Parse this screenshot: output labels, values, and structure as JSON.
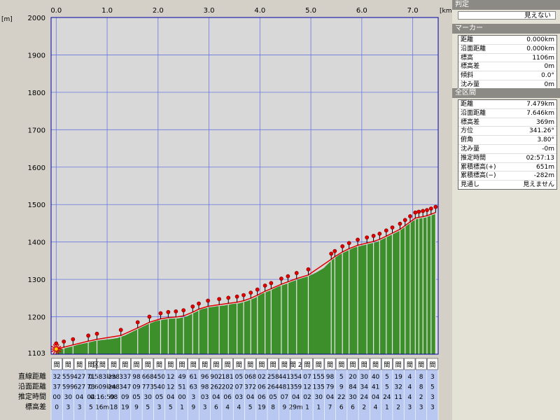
{
  "chart_data": {
    "type": "area",
    "title": "",
    "xunit": "[km]",
    "yunit": "[m]",
    "xlim": [
      -0.1,
      7.5
    ],
    "ylim": [
      1100,
      2000
    ],
    "x_ticks": [
      "0.0",
      "1.0",
      "2.0",
      "3.0",
      "4.0",
      "5.0",
      "6.0",
      "7.0"
    ],
    "y_ticks": [
      "2000",
      "1900",
      "1800",
      "1700",
      "1600",
      "1500",
      "1400",
      "1300",
      "1200"
    ],
    "y_bottom_label": "1103",
    "profile": [
      [
        0.0,
        1110
      ],
      [
        0.15,
        1115
      ],
      [
        0.3,
        1120
      ],
      [
        0.45,
        1126
      ],
      [
        0.6,
        1130
      ],
      [
        0.75,
        1135
      ],
      [
        0.9,
        1138
      ],
      [
        1.05,
        1140
      ],
      [
        1.2,
        1143
      ],
      [
        1.35,
        1150
      ],
      [
        1.5,
        1160
      ],
      [
        1.65,
        1170
      ],
      [
        1.8,
        1180
      ],
      [
        1.95,
        1188
      ],
      [
        2.1,
        1192
      ],
      [
        2.25,
        1195
      ],
      [
        2.4,
        1196
      ],
      [
        2.55,
        1200
      ],
      [
        2.7,
        1210
      ],
      [
        2.85,
        1220
      ],
      [
        3.0,
        1225
      ],
      [
        3.15,
        1228
      ],
      [
        3.3,
        1230
      ],
      [
        3.45,
        1234
      ],
      [
        3.6,
        1236
      ],
      [
        3.75,
        1242
      ],
      [
        3.9,
        1250
      ],
      [
        4.05,
        1262
      ],
      [
        4.2,
        1270
      ],
      [
        4.35,
        1280
      ],
      [
        4.5,
        1287
      ],
      [
        4.65,
        1295
      ],
      [
        4.8,
        1302
      ],
      [
        4.95,
        1308
      ],
      [
        5.1,
        1318
      ],
      [
        5.25,
        1330
      ],
      [
        5.4,
        1350
      ],
      [
        5.55,
        1365
      ],
      [
        5.7,
        1375
      ],
      [
        5.85,
        1385
      ],
      [
        6.0,
        1390
      ],
      [
        6.15,
        1395
      ],
      [
        6.3,
        1400
      ],
      [
        6.45,
        1410
      ],
      [
        6.6,
        1420
      ],
      [
        6.75,
        1430
      ],
      [
        6.85,
        1440
      ],
      [
        6.95,
        1450
      ],
      [
        7.05,
        1460
      ],
      [
        7.15,
        1463
      ],
      [
        7.25,
        1465
      ],
      [
        7.35,
        1470
      ],
      [
        7.45,
        1475
      ]
    ],
    "marker_x": [
      0.0,
      0.15,
      0.33,
      0.63,
      0.8,
      1.27,
      1.6,
      1.83,
      2.05,
      2.2,
      2.35,
      2.5,
      2.68,
      2.8,
      2.98,
      3.2,
      3.38,
      3.55,
      3.68,
      3.82,
      3.95,
      4.1,
      4.22,
      4.42,
      4.55,
      4.72,
      4.95,
      5.4,
      5.47,
      5.62,
      5.75,
      5.92,
      6.1,
      6.23,
      6.35,
      6.48,
      6.6,
      6.75,
      6.85,
      6.95,
      7.05,
      7.12,
      7.2,
      7.28,
      7.36,
      7.45
    ],
    "rows": [
      {
        "label": "直線距離",
        "values": [
          "32",
          "559",
          "427",
          "71",
          "0.583km",
          "238",
          "337",
          "98",
          "668",
          "450",
          "12",
          "49",
          "61",
          "96",
          "902",
          "181",
          "05",
          "068",
          "02",
          "258",
          "441",
          "354",
          "07",
          "155",
          "98",
          "5",
          "20",
          "30",
          "40",
          "5",
          "19",
          "4",
          "8",
          "3"
        ]
      },
      {
        "label": "沿面距離",
        "values": [
          "37",
          "599",
          "627",
          "73",
          "0.609km",
          "248",
          "347",
          "09",
          "773",
          "540",
          "12",
          "51",
          "63",
          "98",
          "262",
          "202",
          "07",
          "372",
          "06",
          "264",
          "481",
          "359",
          "12",
          "135",
          "79",
          "9",
          "84",
          "34",
          "41",
          "5",
          "32",
          "4",
          "8",
          "5"
        ]
      },
      {
        "label": "推定時間",
        "values": [
          "00",
          "30",
          "04",
          "04",
          "0:16:59",
          "08",
          "09",
          "05",
          "30",
          "05",
          "04",
          "00",
          "3",
          "03",
          "04",
          "06",
          "03",
          "04",
          "06",
          "05",
          "07",
          "04",
          "02",
          "30",
          "04",
          "22",
          "30",
          "24",
          "04",
          "24",
          "11",
          "4",
          "2",
          "3"
        ]
      },
      {
        "label": "標高差",
        "values": [
          "0",
          "3",
          "3",
          "5",
          "16m",
          "18",
          "19",
          "9",
          "5",
          "3",
          "5",
          "1",
          "9",
          "3",
          "6",
          "4",
          "4",
          "5",
          "19",
          "8",
          "9",
          "29m",
          "1",
          "1",
          "7",
          "6",
          "6",
          "2",
          "4",
          "1",
          "2",
          "3",
          "3",
          "3"
        ]
      }
    ],
    "segment_header": [
      "間",
      "間",
      "間",
      "間",
      "区間 6",
      "間",
      "間",
      "間",
      "間",
      "間",
      "間",
      "間",
      "間",
      "間",
      "間",
      "間",
      "間",
      "間",
      "間",
      "間",
      "間",
      "間 2",
      "間",
      "間",
      "間",
      "間",
      "間",
      "間",
      "間",
      "間",
      "間",
      "間",
      "間",
      "間"
    ]
  },
  "panel": {
    "judge_title": "判定",
    "judge_value": "見えない",
    "marker_title": "マーカー",
    "marker_rows": [
      {
        "k": "距離",
        "v": "0.000km"
      },
      {
        "k": "沿面距離",
        "v": "0.000km"
      },
      {
        "k": "標高",
        "v": "1106m"
      },
      {
        "k": "標高差",
        "v": "0m"
      },
      {
        "k": "傾斜",
        "v": "0.0°"
      },
      {
        "k": "沈み量",
        "v": "0m"
      }
    ],
    "all_title": "全区間",
    "all_rows": [
      {
        "k": "距離",
        "v": "7.479km"
      },
      {
        "k": "沿面距離",
        "v": "7.646km"
      },
      {
        "k": "標高差",
        "v": "369m"
      },
      {
        "k": "方位",
        "v": "341.26°"
      },
      {
        "k": "俯角",
        "v": "3.80°"
      },
      {
        "k": "沈み量",
        "v": "-0m"
      },
      {
        "k": "推定時間",
        "v": "02:57:13"
      },
      {
        "k": "累積標高(+)",
        "v": "651m"
      },
      {
        "k": "累積標高(−)",
        "v": "-282m"
      },
      {
        "k": "見通し",
        "v": "見えません"
      }
    ]
  },
  "colors": {
    "plot_bg": "#d8d8d8",
    "grid": "#6878e0",
    "terrain": "#3c8f2a",
    "line": "#e00000",
    "marker": "#e00000",
    "table_bg": "#b8c8f0",
    "frame": "#0000a0"
  }
}
